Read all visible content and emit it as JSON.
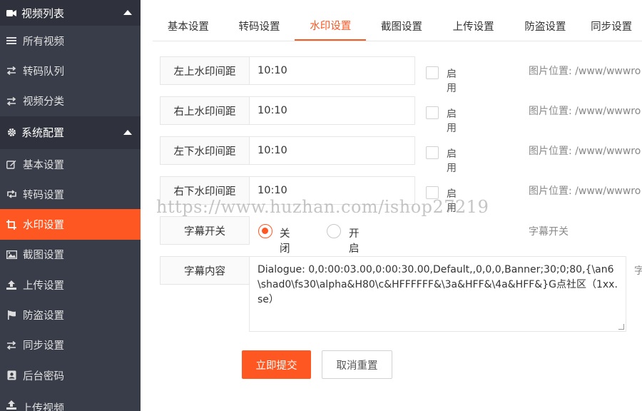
{
  "sidebar": {
    "video_group": {
      "title": "视频列表",
      "icon": "video-camera-icon"
    },
    "video_items": [
      {
        "label": "所有视频",
        "icon": "list-icon"
      },
      {
        "label": "转码队列",
        "icon": "exchange-icon"
      },
      {
        "label": "视频分类",
        "icon": "exchange-icon"
      }
    ],
    "config_group": {
      "title": "系统配置",
      "icon": "gear-icon"
    },
    "config_items": [
      {
        "label": "基本设置",
        "icon": "edit-icon"
      },
      {
        "label": "转码设置",
        "icon": "retweet-icon"
      },
      {
        "label": "水印设置",
        "icon": "crop-icon"
      },
      {
        "label": "截图设置",
        "icon": "image-icon"
      },
      {
        "label": "上传设置",
        "icon": "upload-icon"
      },
      {
        "label": "防盗设置",
        "icon": "flag-icon"
      },
      {
        "label": "同步设置",
        "icon": "exchange-icon"
      },
      {
        "label": "后台密码",
        "icon": "id-card-icon"
      }
    ],
    "upload_group": {
      "title": "上传视频",
      "icon": "upload-icon"
    }
  },
  "tabs": [
    "基本设置",
    "转码设置",
    "水印设置",
    "截图设置",
    "上传设置",
    "防盗设置",
    "同步设置"
  ],
  "active_tab": "水印设置",
  "form": {
    "watermark_rows": [
      {
        "label": "左上水印间距",
        "value": "10:10",
        "enable_label": "启用",
        "hint": "图片位置: /www/wwwro"
      },
      {
        "label": "右上水印间距",
        "value": "10:10",
        "enable_label": "启用",
        "hint": "图片位置: /www/wwwro"
      },
      {
        "label": "左下水印间距",
        "value": "10:10",
        "enable_label": "启用",
        "hint": "图片位置: /www/wwwro"
      },
      {
        "label": "右下水印间距",
        "value": "10:10",
        "enable_label": "启用",
        "hint": "图片位置: /www/wwwro"
      }
    ],
    "subtitle_switch": {
      "label": "字幕开关",
      "off_label": "关闭",
      "on_label": "开启",
      "selected": "关闭",
      "hint": "字幕开关"
    },
    "subtitle_content": {
      "label": "字幕内容",
      "value": "Dialogue: 0,0:00:03.00,0:00:30.00,Default,,0,0,0,Banner;30;0;80,{\\an6\\shad0\\fs30\\alpha&H80\\c&HFFFFFF&\\3a&HFF&\\4a&HFF&}G点社区（1xx.se）",
      "hint": "字"
    },
    "submit_label": "立即提交",
    "reset_label": "取消重置"
  },
  "watermark_text": "https://www.huzhan.com/ishop27219",
  "colors": {
    "sidebar_bg": "#393d49",
    "sidebar_header_bg": "#2f323c",
    "accent": "#ff5722"
  }
}
